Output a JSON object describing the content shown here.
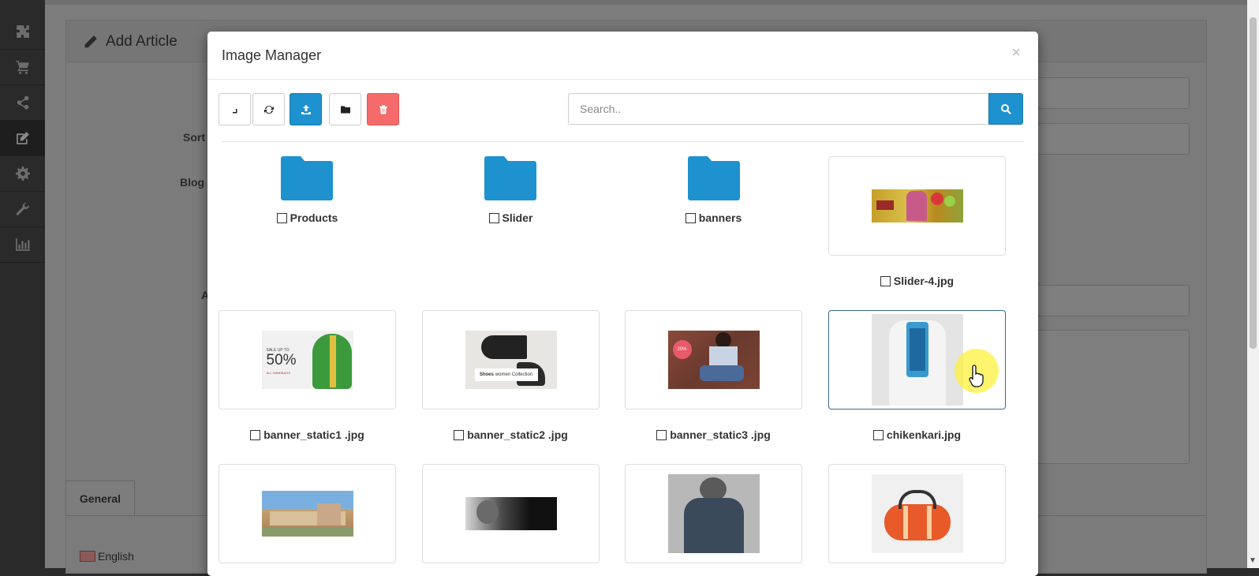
{
  "page": {
    "title": "Add Article",
    "labels": {
      "sort": "Sort",
      "blog": "Blog",
      "a": "A"
    },
    "tab_general": "General",
    "language": "English"
  },
  "sidebar": {
    "items": [
      {
        "icon": "puzzle-icon"
      },
      {
        "icon": "cart-icon"
      },
      {
        "icon": "share-icon"
      },
      {
        "icon": "edit-icon",
        "active": true
      },
      {
        "icon": "gear-icon"
      },
      {
        "icon": "wrench-icon"
      },
      {
        "icon": "bar-chart-icon"
      }
    ]
  },
  "modal": {
    "title": "Image Manager",
    "close": "×",
    "search_placeholder": "Search..",
    "toolbar": [
      "parent-level-icon",
      "refresh-icon",
      "upload-icon",
      "new-folder-icon",
      "delete-icon"
    ],
    "folders": [
      {
        "name": "Products"
      },
      {
        "name": "Slider"
      },
      {
        "name": "banners"
      }
    ],
    "images": [
      {
        "name": "Slider-4.jpg"
      },
      {
        "name": "banner_static1 .jpg",
        "text_big": "50%",
        "text_small": "SALE UP TO",
        "text_tiny": "ALL HANDBAGS"
      },
      {
        "name": "banner_static2 .jpg",
        "text": "Shoes",
        "text_sub": "women Collection"
      },
      {
        "name": "banner_static3 .jpg",
        "badge": "20%"
      },
      {
        "name": "chikenkari.jpg"
      },
      {
        "name": ""
      },
      {
        "name": ""
      },
      {
        "name": ""
      },
      {
        "name": ""
      }
    ]
  },
  "colors": {
    "primary": "#1e91cf",
    "danger": "#f56b6b",
    "folder": "#1e91cf"
  }
}
